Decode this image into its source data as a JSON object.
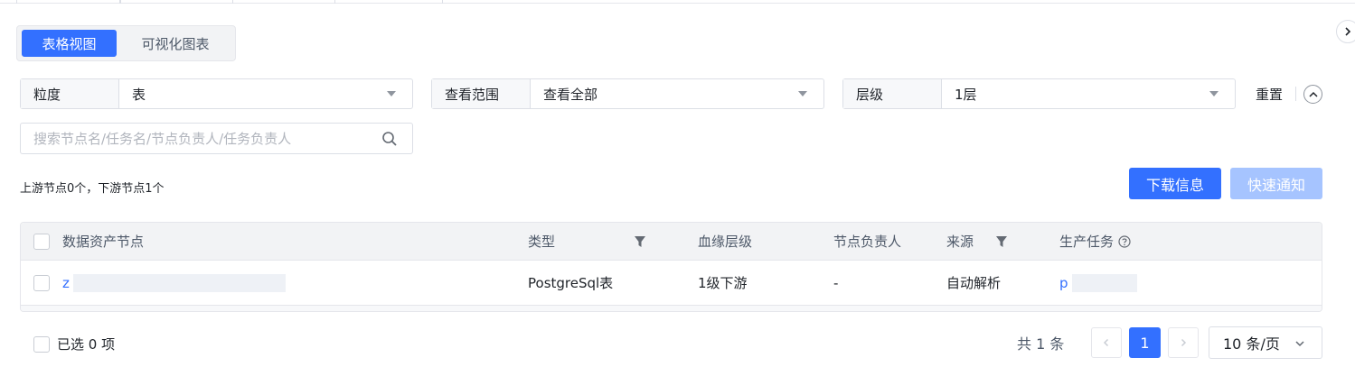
{
  "view_switch": {
    "table_view": "表格视图",
    "chart_view": "可视化图表"
  },
  "filters": [
    {
      "label": "粒度",
      "value": "表"
    },
    {
      "label": "查看范围",
      "value": "查看全部"
    },
    {
      "label": "层级",
      "value": "1层"
    }
  ],
  "reset_label": "重置",
  "search": {
    "placeholder": "搜索节点名/任务名/节点负责人/任务负责人",
    "value": ""
  },
  "stats": "上游节点0个，下游节点1个",
  "actions": {
    "download": "下载信息",
    "notify": "快速通知"
  },
  "table": {
    "headers": [
      "数据资产节点",
      "类型",
      "血缘层级",
      "节点负责人",
      "来源",
      "生产任务"
    ],
    "rows": [
      {
        "node": "z",
        "type": "PostgreSql表",
        "level": "1级下游",
        "owner": "-",
        "source": "自动解析",
        "task": "p"
      }
    ]
  },
  "footer": {
    "selected": "已选 0 项",
    "total": "共 1 条",
    "current_page": "1",
    "page_size": "10 条/页"
  },
  "colors": {
    "primary": "#3370ff",
    "primary_disabled": "#a6c4ff"
  }
}
